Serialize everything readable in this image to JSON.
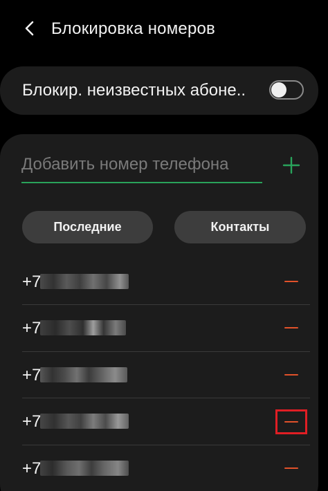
{
  "header": {
    "title": "Блокировка номеров",
    "back_icon": "chevron-left-icon"
  },
  "unknown_callers": {
    "label": "Блокир. неизвестных абоне..",
    "enabled": false
  },
  "add_number": {
    "value": "",
    "placeholder": "Добавить номер телефона",
    "add_icon": "plus-icon",
    "accent_color": "#29a35b"
  },
  "buttons": {
    "recent": "Последние",
    "contacts": "Контакты"
  },
  "blocked_numbers": [
    {
      "prefix": "+7",
      "highlighted": false
    },
    {
      "prefix": "+7",
      "highlighted": false
    },
    {
      "prefix": "+7",
      "highlighted": false
    },
    {
      "prefix": "+7",
      "highlighted": true
    },
    {
      "prefix": "+7",
      "highlighted": false
    }
  ],
  "colors": {
    "background": "#000000",
    "card": "#1c1c1c",
    "pill": "#3d3d3d",
    "remove": "#e2522a",
    "highlight_box": "#e01e24"
  },
  "icons": {
    "remove": "minus-icon"
  }
}
